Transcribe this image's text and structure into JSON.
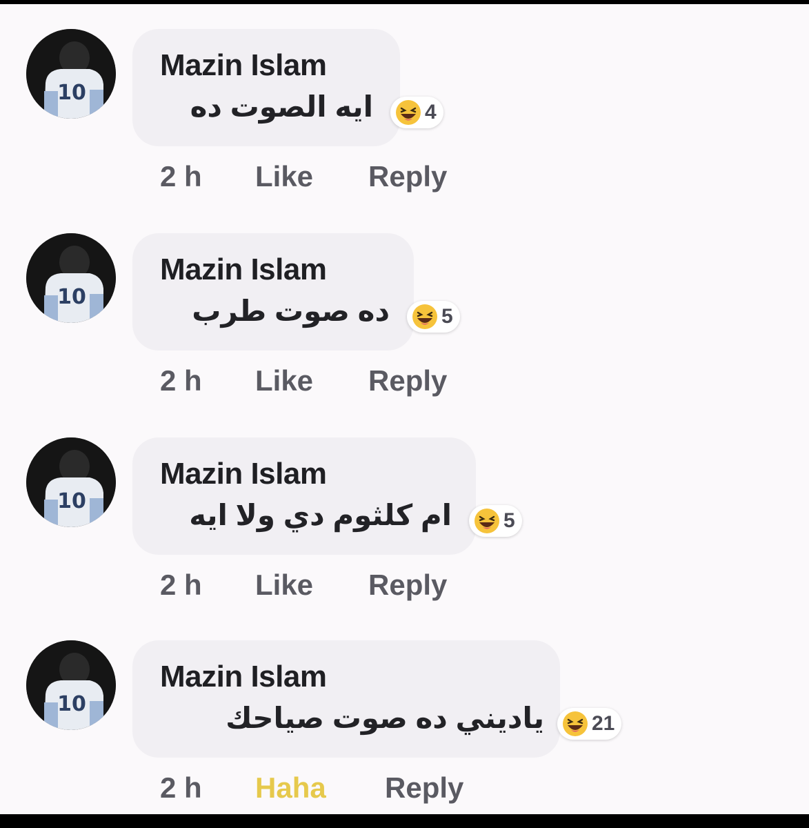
{
  "comments": [
    {
      "author": "Mazin Islam",
      "text": "ايه الصوت ده",
      "reaction_count": "4",
      "time": "2 h",
      "like_label": "Like",
      "reply_label": "Reply"
    },
    {
      "author": "Mazin Islam",
      "text": "ده صوت طرب",
      "reaction_count": "5",
      "time": "2 h",
      "like_label": "Like",
      "reply_label": "Reply"
    },
    {
      "author": "Mazin Islam",
      "text": "ام كلثوم دي ولا ايه",
      "reaction_count": "5",
      "time": "2 h",
      "like_label": "Like",
      "reply_label": "Reply"
    },
    {
      "author": "Mazin Islam",
      "text": "ياديني ده صوت صياحك",
      "reaction_count": "21",
      "time": "2 h",
      "like_label": "Haha",
      "reply_label": "Reply"
    }
  ],
  "icons": {
    "reaction": "haha-emoji-icon",
    "avatar": "jersey-10-avatar"
  },
  "colors": {
    "background": "#fbf9fb",
    "bubble": "#f1eff3",
    "haha_active": "#e6c94c",
    "emoji_yellow": "#f6c33b"
  }
}
